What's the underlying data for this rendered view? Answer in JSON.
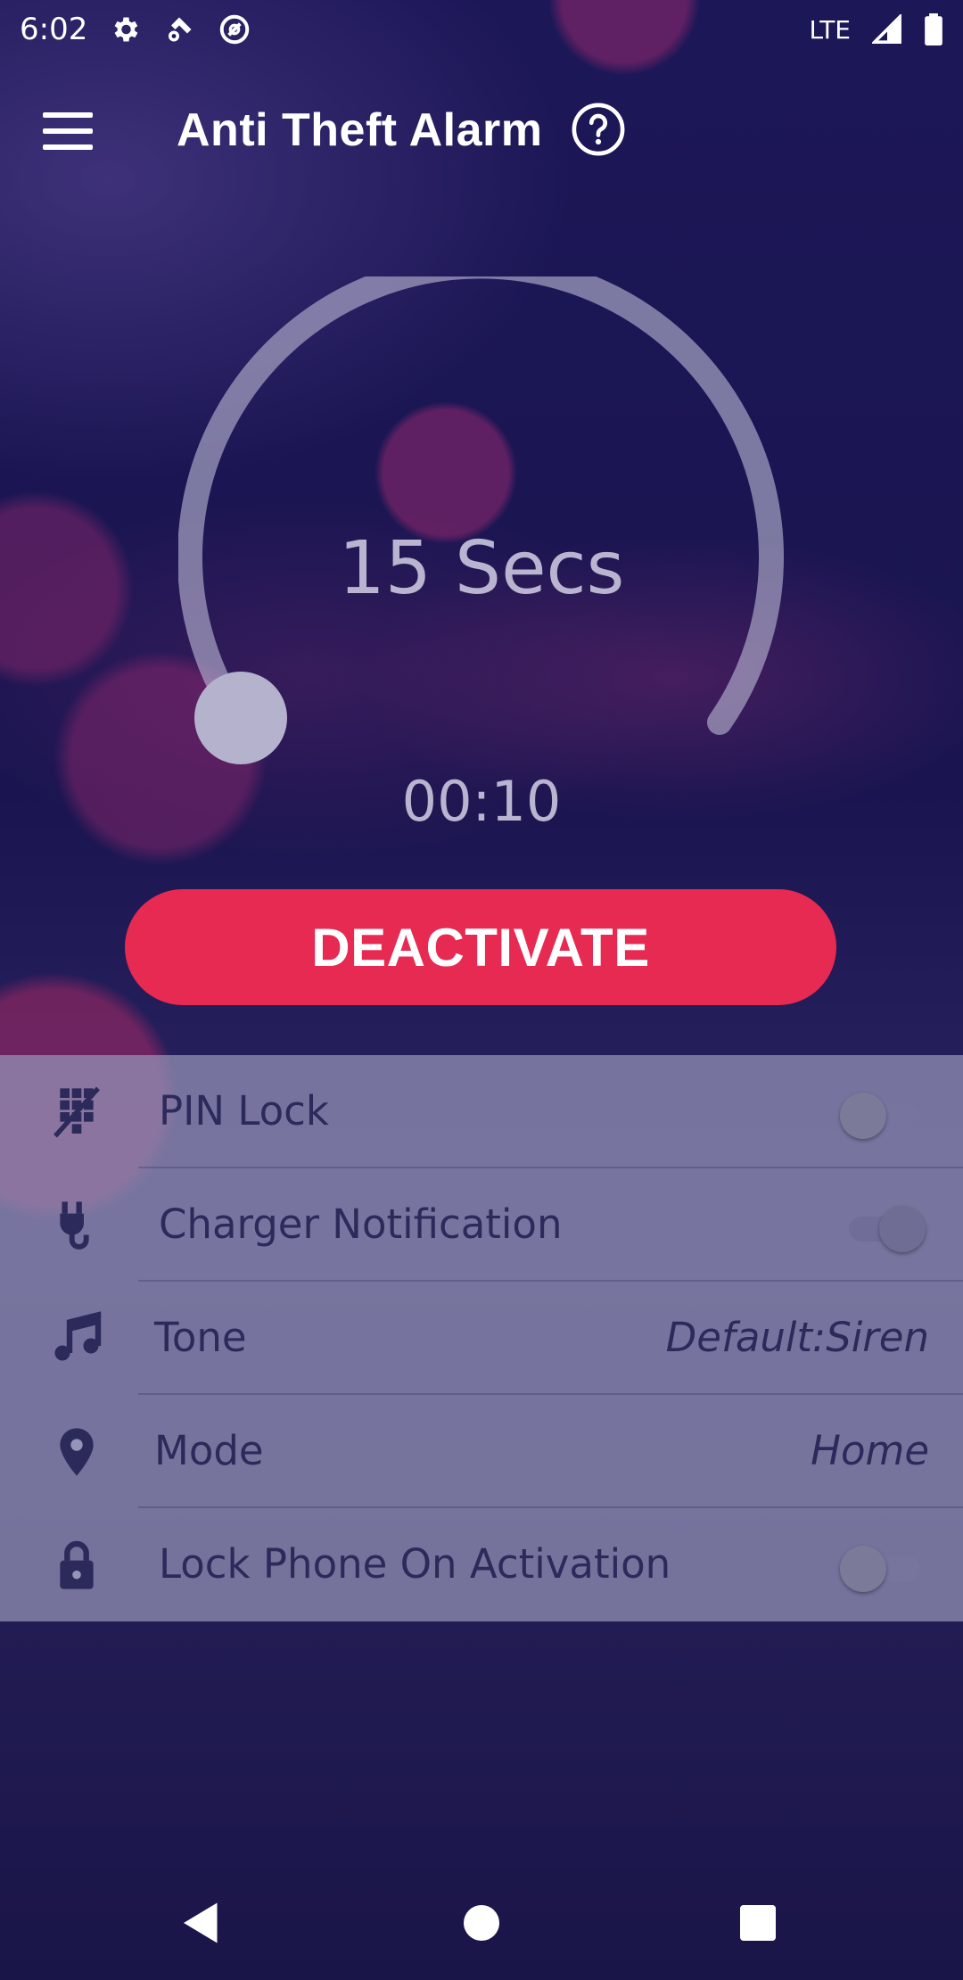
{
  "status_bar": {
    "time": "6:02",
    "network": "LTE",
    "icons": [
      "gear-icon",
      "wifi-settings-icon",
      "at-sign-icon",
      "signal-icon",
      "battery-icon"
    ]
  },
  "toolbar": {
    "title": "Anti Theft Alarm",
    "menu_icon": "hamburger-menu-icon",
    "help_icon": "help-circle-icon"
  },
  "dial": {
    "label": "15 Secs",
    "progress": 0.15
  },
  "timer": "00:10",
  "deactivate_button": "DEACTIVATE",
  "settings": {
    "rows": [
      {
        "label": "PIN Lock",
        "icon": "pin-lock-icon",
        "toggle": false
      },
      {
        "label": "Charger Notification",
        "icon": "charger-plug-icon",
        "toggle": true
      },
      {
        "label": "Tone",
        "icon": "music-note-icon",
        "value": "Default:Siren"
      },
      {
        "label": "Mode",
        "icon": "location-pin-icon",
        "value": "Home"
      },
      {
        "label": "Lock Phone On Activation",
        "icon": "lock-icon",
        "toggle": false
      }
    ]
  },
  "nav_bar": {
    "icons": [
      "back-icon",
      "home-icon",
      "recents-icon"
    ]
  },
  "colors": {
    "accent": "#e62a52",
    "background": "#15103f",
    "settings_text": "#2c2a5a"
  }
}
